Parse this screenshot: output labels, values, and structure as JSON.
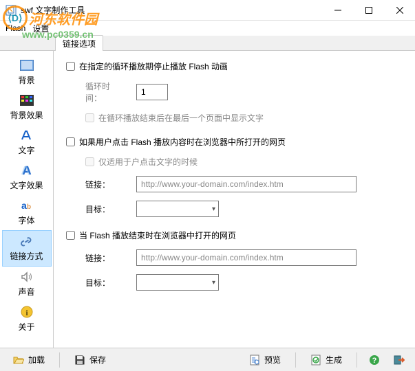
{
  "titlebar": {
    "title": "swf 文字制作工具"
  },
  "menubar": {
    "flash": "Flash",
    "settings": "设置"
  },
  "tab": {
    "label": "链接选项"
  },
  "sidebar": {
    "items": [
      {
        "label": "背景"
      },
      {
        "label": "背景效果"
      },
      {
        "label": "文字"
      },
      {
        "label": "文字效果"
      },
      {
        "label": "字体"
      },
      {
        "label": "链接方式"
      },
      {
        "label": "声音"
      },
      {
        "label": "关于"
      }
    ]
  },
  "content": {
    "sec1": {
      "chk": "在指定的循环播放期停止播放 Flash 动画",
      "loop_label": "循环时间：",
      "loop_value": "1",
      "sub_chk": "在循环播放结束后在最后一个页面中显示文字"
    },
    "sec2": {
      "chk": "如果用户点击 Flash 播放内容时在浏览器中所打开的网页",
      "sub_chk": "仅适用于户点击文字的时候",
      "link_label": "链接：",
      "link_value": "http://www.your-domain.com/index.htm",
      "target_label": "目标："
    },
    "sec3": {
      "chk": "当 Flash 播放结束时在浏览器中打开的网页",
      "link_label": "链接：",
      "link_value": "http://www.your-domain.com/index.htm",
      "target_label": "目标："
    }
  },
  "toolbar": {
    "load": "加载",
    "save": "保存",
    "preview": "预览",
    "generate": "生成"
  },
  "watermark": {
    "text": "河东软件园",
    "url": "www.pc0359.cn"
  }
}
